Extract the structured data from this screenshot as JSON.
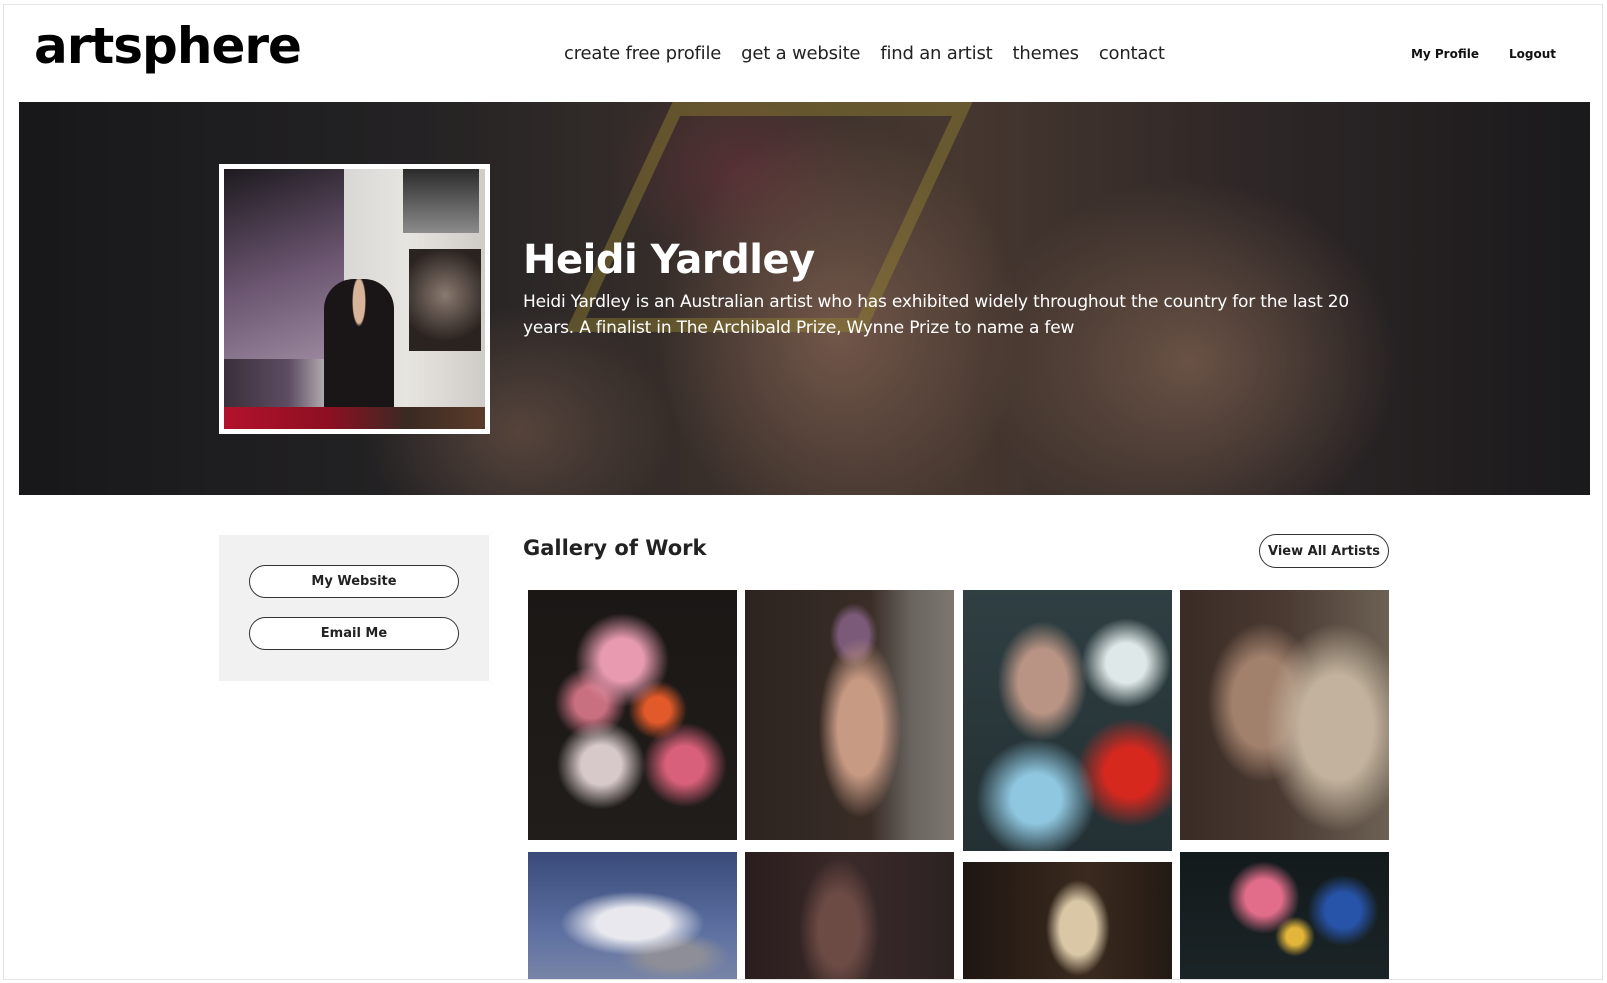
{
  "brand": {
    "logo_text": "artsphere"
  },
  "nav": {
    "items": [
      {
        "label": "create free profile"
      },
      {
        "label": "get a website"
      },
      {
        "label": "find an artist"
      },
      {
        "label": "themes"
      },
      {
        "label": "contact"
      }
    ]
  },
  "account": {
    "profile_label": "My Profile",
    "logout_label": "Logout"
  },
  "hero": {
    "name": "Heidi Yardley",
    "bio": "Heidi Yardley is an Australian artist who has exhibited widely throughout the country for the last 20 years. A finalist in The Archibald Prize, Wynne Prize to name a few"
  },
  "sidebar": {
    "website_label": "My Website",
    "email_label": "Email Me"
  },
  "gallery": {
    "title": "Gallery of Work",
    "view_all_label": "View All Artists",
    "items": [
      {
        "subject": "flower still life"
      },
      {
        "subject": "figure in doorway"
      },
      {
        "subject": "woman with flowers"
      },
      {
        "subject": "woman in profile"
      },
      {
        "subject": "clouds"
      },
      {
        "subject": "figure"
      },
      {
        "subject": "figure in light"
      },
      {
        "subject": "rose still life"
      }
    ]
  },
  "colors": {
    "text": "#111111",
    "sidebar_bg": "#f1f1f1",
    "hero_text": "#ffffff"
  }
}
